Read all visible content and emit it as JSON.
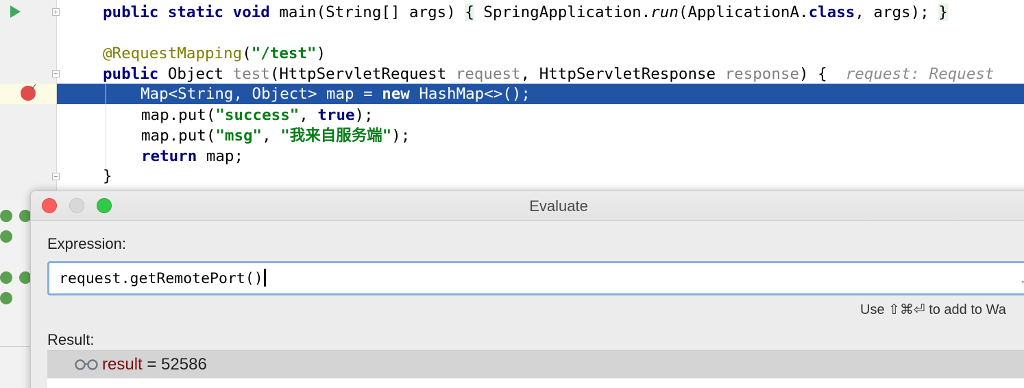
{
  "editor": {
    "line1": {
      "kw1": "public static void",
      "t1": " main(String[] args) ",
      "brace_open": "{",
      "t2": " SpringApplication.",
      "run": "run",
      "t3": "(ApplicationA.",
      "kw_class": "class",
      "t4": ", args); ",
      "brace_close": "}"
    },
    "line2": {
      "ann": "@RequestMapping",
      "paren_open": "(",
      "str": "\"/test\"",
      "paren_close": ")"
    },
    "line3": {
      "kw": "public",
      "t1": " Object ",
      "method": "test",
      "t2": "(HttpServletRequest ",
      "p1": "request",
      "t3": ", HttpServletResponse ",
      "p2": "response",
      "t4": ") {  ",
      "hint": "request: Request"
    },
    "line4": {
      "t1": "Map<String, Object> map = ",
      "kw": "new",
      "t2": " HashMap<>();"
    },
    "line5": {
      "t1": "map.put(",
      "str": "\"success\"",
      "t2": ", ",
      "kw": "true",
      "t3": ");"
    },
    "line6": {
      "t1": "map.put(",
      "str1": "\"msg\"",
      "t2": ", ",
      "str2": "\"我来自服务端\"",
      "t3": ");"
    },
    "line7": {
      "kw": "return",
      "t1": " map;"
    },
    "line8": {
      "t1": "}"
    }
  },
  "dialog": {
    "title": "Evaluate",
    "expression_label": "Expression:",
    "expression_value": "request.getRemotePort()",
    "hint_text": "Use ⇧⌘⏎ to add to Wa",
    "result_label": "Result:",
    "result": {
      "name": "result",
      "equals": " = ",
      "value": "52586"
    }
  },
  "colors": {
    "execution_line": "#2154a4",
    "keyword": "#000080",
    "string": "#067d17",
    "annotation": "#808000",
    "breakpoint": "#e04b4b",
    "result_name": "#7a0d0d"
  },
  "icons": [
    "run-icon",
    "fold-icon",
    "breakpoint-icon",
    "glasses-icon",
    "expand-icon"
  ]
}
